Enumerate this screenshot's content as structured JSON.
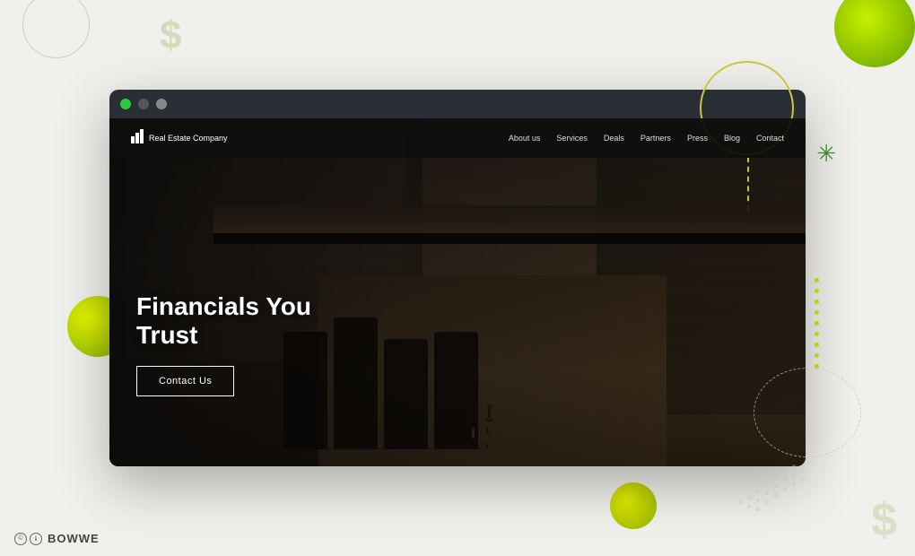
{
  "page": {
    "background_color": "#f0f0ec"
  },
  "browser": {
    "title": "Real Estate Company",
    "traffic_lights": {
      "green": "green",
      "yellow": "yellow",
      "gray": "gray"
    }
  },
  "navbar": {
    "logo_text": "Real Estate Company",
    "logo_icon": "🏛",
    "links": [
      {
        "label": "About us",
        "id": "about-us"
      },
      {
        "label": "Services",
        "id": "services"
      },
      {
        "label": "Deals",
        "id": "deals"
      },
      {
        "label": "Partners",
        "id": "partners"
      },
      {
        "label": "Press",
        "id": "press"
      },
      {
        "label": "Blog",
        "id": "blog"
      },
      {
        "label": "Contact",
        "id": "contact"
      }
    ]
  },
  "hero": {
    "title_line1": "Financials You",
    "title_line2": "Trust",
    "cta_button": "Contact Us"
  },
  "decorations": {
    "dollar_symbol": "$",
    "watermark_text": "BOWWE",
    "copyright_symbol": "©",
    "creative_commons": "Ⓒ",
    "info_icon": "ℹ"
  }
}
